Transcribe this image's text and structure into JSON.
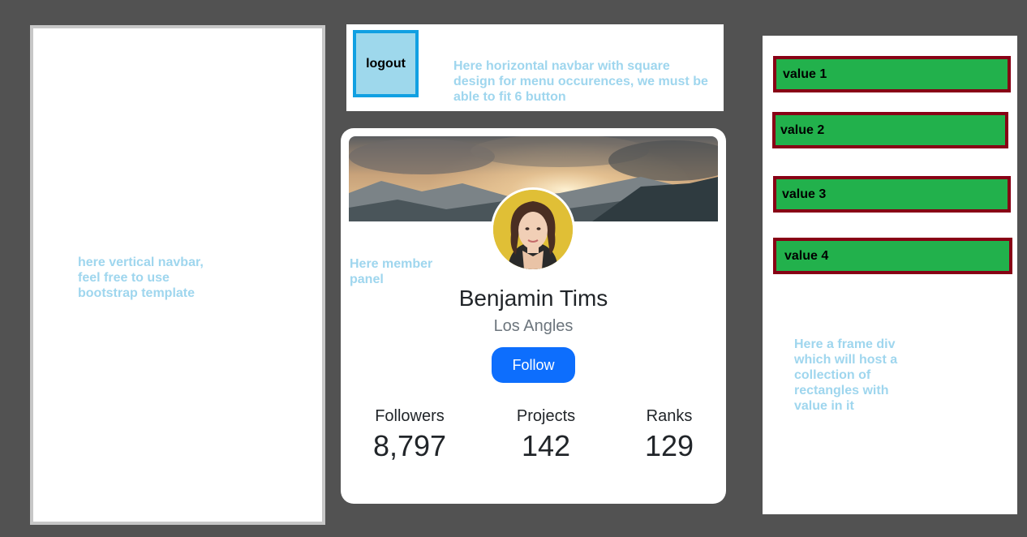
{
  "left_nav": {
    "note": "here vertical navbar, feel free to use bootstrap template"
  },
  "top_nav": {
    "logout_label": "logout",
    "note": "Here horizontal navbar with square design for menu occurences, we must be able to fit 6 button"
  },
  "member_panel": {
    "note": "Here member panel",
    "name": "Benjamin Tims",
    "location": "Los Angles",
    "follow_label": "Follow",
    "stats": [
      {
        "label": "Followers",
        "value": "8,797"
      },
      {
        "label": "Projects",
        "value": "142"
      },
      {
        "label": "Ranks",
        "value": "129"
      }
    ]
  },
  "frame": {
    "values": [
      "value 1",
      "value 2",
      "value 3",
      "value 4"
    ],
    "note": "Here a frame div which will host a collection of rectangles with value in it"
  },
  "colors": {
    "background": "#525252",
    "note_text": "#9fd6ee",
    "logout_fill": "#9ed8ec",
    "logout_border": "#11a0e2",
    "follow_button": "#0d6efd",
    "value_fill": "#22b14c",
    "value_border": "#880015"
  }
}
